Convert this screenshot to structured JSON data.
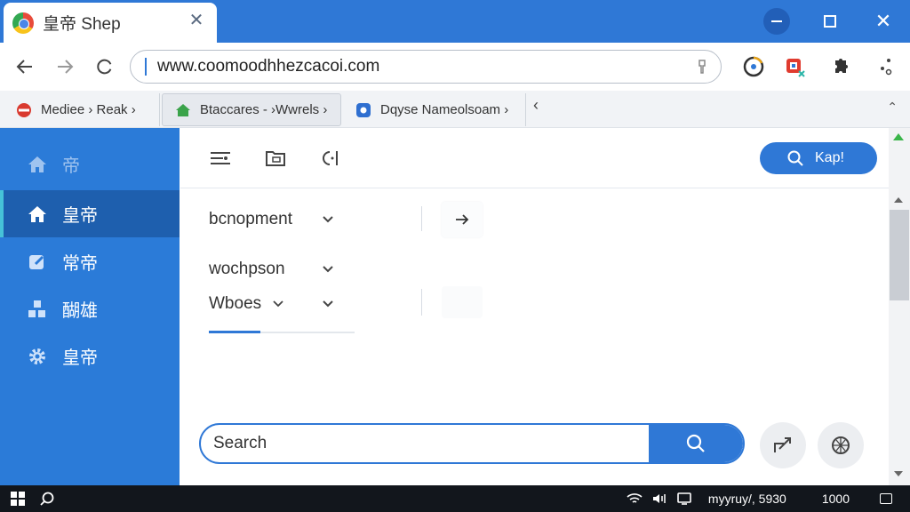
{
  "window": {
    "tab_title": "皇帝 Shep",
    "close_tab": "✕",
    "close_window": "✕"
  },
  "toolbar": {
    "url": "www.coomoodhhezcacoi.com"
  },
  "bookmarks": [
    {
      "label": "Mediee › Reak ›",
      "icon": "red-bookmark-icon",
      "color": "#d93a2f"
    },
    {
      "label": "Btaccares - ›Wwrels ›",
      "icon": "green-home-icon",
      "color": "#3aa34a"
    },
    {
      "label": "Dqyse Nameolsoam ›",
      "icon": "blue-app-icon",
      "color": "#2f6fd0"
    }
  ],
  "bookmarks_back": "‹",
  "bookmarks_more": "⌃",
  "sidebar": {
    "header_label": "帝",
    "items": [
      {
        "label": "皇帝",
        "icon": "home-icon"
      },
      {
        "label": "常帝",
        "icon": "edit-icon"
      },
      {
        "label": "醐雄",
        "icon": "blocks-icon"
      },
      {
        "label": "皇帝",
        "icon": "gear-icon"
      }
    ]
  },
  "main": {
    "primary_button": "Kap!",
    "dropdowns": [
      {
        "label": "bcnopment"
      },
      {
        "label": "wochpson"
      },
      {
        "label": "Wboes"
      }
    ],
    "wboes_inline_chevron": "⌄"
  },
  "search": {
    "placeholder": "Search"
  },
  "taskbar": {
    "clock": "myyruy/, 5930",
    "time": "1000"
  },
  "colors": {
    "accent": "#2f78d6",
    "sidebar": "#2b7bd8",
    "sidebar_active": "#1e5fae"
  }
}
